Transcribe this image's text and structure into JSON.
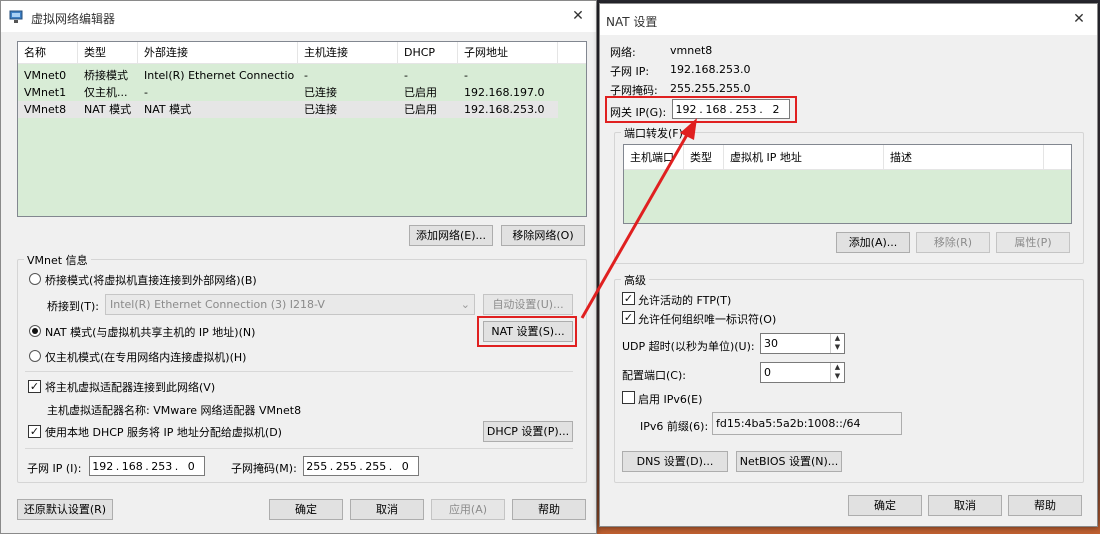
{
  "left": {
    "title": "虚拟网络编辑器",
    "table": {
      "columns": [
        "名称",
        "类型",
        "外部连接",
        "主机连接",
        "DHCP",
        "子网地址"
      ],
      "rows": [
        [
          "VMnet0",
          "桥接模式",
          "Intel(R) Ethernet Connectio...",
          "-",
          "-",
          "-"
        ],
        [
          "VMnet1",
          "仅主机...",
          "-",
          "已连接",
          "已启用",
          "192.168.197.0"
        ],
        [
          "VMnet8",
          "NAT 模式",
          "NAT 模式",
          "已连接",
          "已启用",
          "192.168.253.0"
        ]
      ]
    },
    "add_network": "添加网络(E)...",
    "remove_network": "移除网络(O)",
    "vmnet_info": "VMnet 信息",
    "bridge_mode": "桥接模式(将虚拟机直接连接到外部网络)(B)",
    "bridge_to_label": "桥接到(T):",
    "bridge_to_value": "Intel(R) Ethernet Connection (3) I218-V",
    "auto_settings": "自动设置(U)...",
    "nat_mode": "NAT 模式(与虚拟机共享主机的 IP 地址)(N)",
    "nat_settings": "NAT 设置(S)...",
    "host_only": "仅主机模式(在专用网络内连接虚拟机)(H)",
    "connect_adapter": "将主机虚拟适配器连接到此网络(V)",
    "adapter_name": "主机虚拟适配器名称: VMware 网络适配器 VMnet8",
    "use_dhcp": "使用本地 DHCP 服务将 IP 地址分配给虚拟机(D)",
    "dhcp_settings": "DHCP 设置(P)...",
    "subnet_ip_label": "子网 IP (I):",
    "subnet_ip": [
      "192",
      "168",
      "253",
      "0"
    ],
    "subnet_mask_label": "子网掩码(M):",
    "subnet_mask": [
      "255",
      "255",
      "255",
      "0"
    ],
    "restore_defaults": "还原默认设置(R)",
    "ok": "确定",
    "cancel": "取消",
    "apply": "应用(A)",
    "help": "帮助"
  },
  "right": {
    "title": "NAT 设置",
    "network_label": "网络:",
    "network_value": "vmnet8",
    "subnet_ip_label": "子网 IP:",
    "subnet_ip_value": "192.168.253.0",
    "subnet_mask_label": "子网掩码:",
    "subnet_mask_value": "255.255.255.0",
    "gateway_label": "网关 IP(G):",
    "gateway_ip": [
      "192",
      "168",
      "253",
      "2"
    ],
    "port_forwarding": "端口转发(F)",
    "pf_columns": [
      "主机端口",
      "类型",
      "虚拟机 IP 地址",
      "描述"
    ],
    "add": "添加(A)...",
    "remove": "移除(R)",
    "properties": "属性(P)",
    "advanced": "高级",
    "allow_active_ftp": "允许活动的 FTP(T)",
    "allow_any_oui": "允许任何组织唯一标识符(O)",
    "udp_timeout_label": "UDP 超时(以秒为单位)(U):",
    "udp_timeout_value": "30",
    "config_port_label": "配置端口(C):",
    "config_port_value": "0",
    "enable_ipv6": "启用 IPv6(E)",
    "ipv6_prefix_label": "IPv6 前缀(6):",
    "ipv6_prefix_value": "fd15:4ba5:5a2b:1008::/64",
    "dns_settings": "DNS 设置(D)...",
    "netbios_settings": "NetBIOS 设置(N)...",
    "ok": "确定",
    "cancel": "取消",
    "help": "帮助"
  },
  "colors": {
    "highlight": "#e02020",
    "table_bg": "#d8ecd6"
  }
}
